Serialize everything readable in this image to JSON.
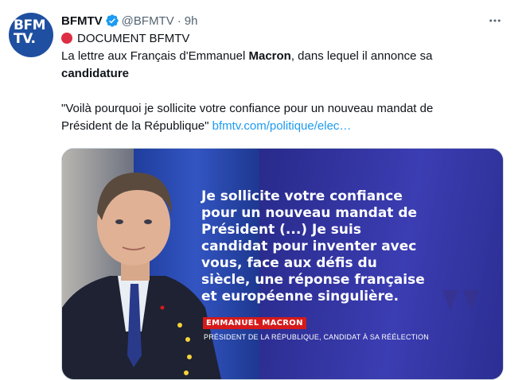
{
  "tweet": {
    "avatar_text_1": "BFM",
    "avatar_text_2": "TV.",
    "display_name": "BFMTV",
    "handle": "@BFMTV",
    "separator": "·",
    "time": "9h",
    "more_icon": "more-horizontal-icon",
    "verified_icon": "verified-badge-icon",
    "line1_text": "DOCUMENT BFMTV",
    "line2_pre": "La lettre aux Français d'Emmanuel ",
    "line2_bold": "Macron",
    "line2_post": ", dans lequel il annonce sa",
    "line3_bold": "candidature",
    "line4": "\"Voilà pourquoi je sollicite votre confiance pour un nouveau mandat de",
    "line5_pre": "Président de la République\" ",
    "line5_link": "bfmtv.com/politique/elec…"
  },
  "media": {
    "quote_lines": [
      "Je sollicite votre confiance",
      "pour un nouveau mandat de",
      "Président (...) Je suis",
      "candidat pour inventer avec",
      "vous, face aux défis du",
      "siècle, une réponse française",
      "et européenne singulière."
    ],
    "name_tag": "EMMANUEL MACRON",
    "caption": "PRÉSIDENT DE LA RÉPUBLIQUE, CANDIDAT À SA RÉÉLECTION"
  },
  "colors": {
    "link": "#1d9bf0",
    "verified": "#1d9bf0",
    "name_tag_bg": "#d61a1a",
    "media_bg": "#2a2b8c",
    "avatar_bg": "#1f4fa0"
  }
}
